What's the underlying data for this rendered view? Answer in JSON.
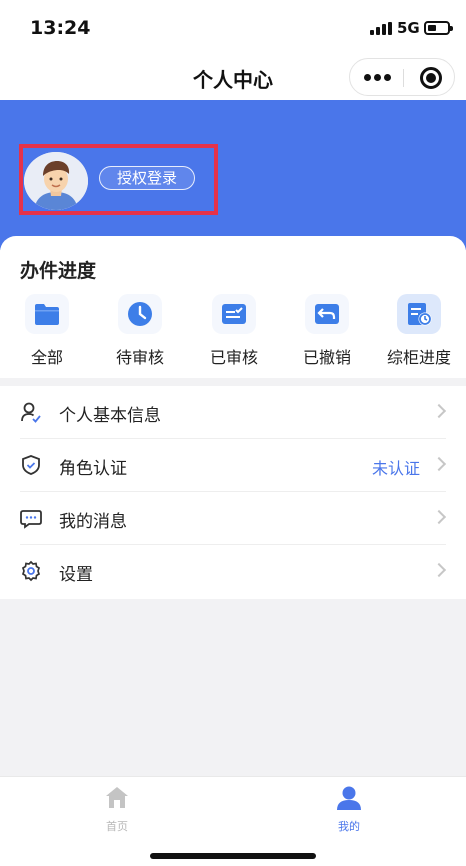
{
  "status_bar": {
    "time": "13:24",
    "network": "5G"
  },
  "nav": {
    "title": "个人中心"
  },
  "header": {
    "login_button": "授权登录",
    "brand_color": "#4a76ea",
    "highlight_color": "#e5324a"
  },
  "progress": {
    "title": "办件进度",
    "items": [
      {
        "label": "全部",
        "icon": "folder-icon"
      },
      {
        "label": "待审核",
        "icon": "clock-icon"
      },
      {
        "label": "已审核",
        "icon": "approved-doc-icon"
      },
      {
        "label": "已撤销",
        "icon": "undo-icon"
      },
      {
        "label": "综柜进度",
        "icon": "doc-clock-icon"
      }
    ]
  },
  "menu": {
    "items": [
      {
        "label": "个人基本信息",
        "status": "",
        "icon": "user-check-icon"
      },
      {
        "label": "角色认证",
        "status": "未认证",
        "icon": "shield-check-icon"
      },
      {
        "label": "我的消息",
        "status": "",
        "icon": "message-icon"
      },
      {
        "label": "设置",
        "status": "",
        "icon": "gear-icon"
      }
    ]
  },
  "tabbar": {
    "items": [
      {
        "label": "首页",
        "icon": "home-icon",
        "active": false
      },
      {
        "label": "我的",
        "icon": "profile-icon",
        "active": true
      }
    ],
    "active_color": "#4a76ea",
    "inactive_color": "#b8b8b8"
  }
}
